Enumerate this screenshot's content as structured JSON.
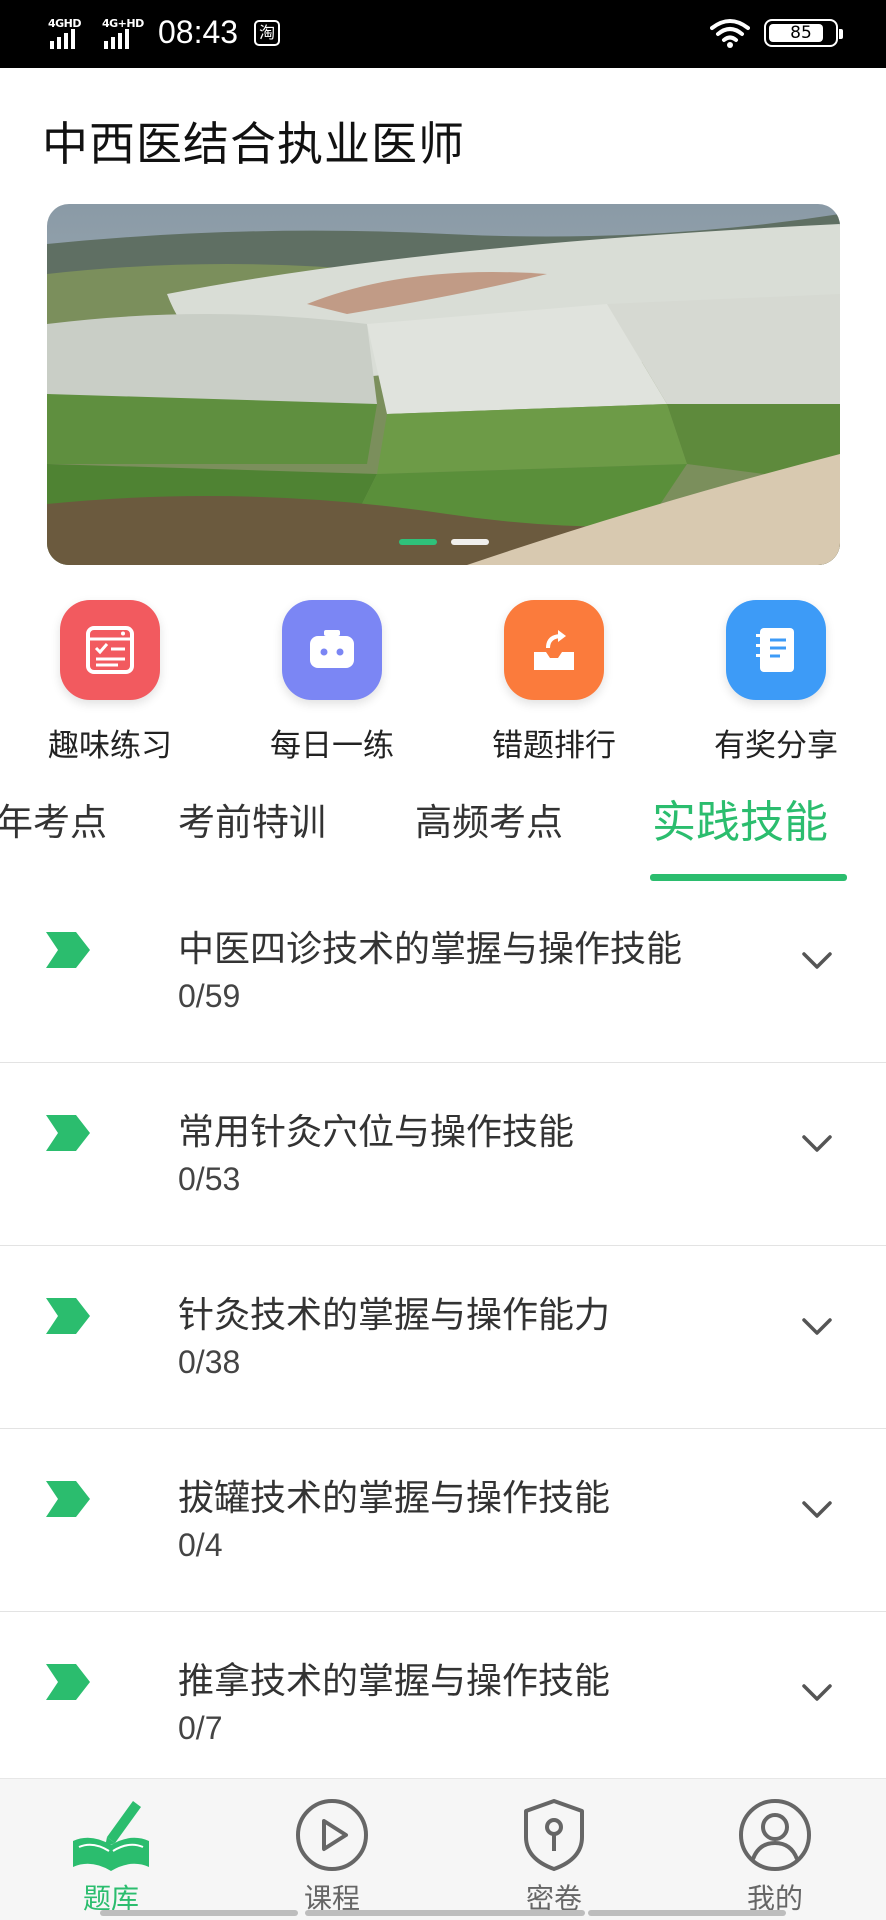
{
  "status_bar": {
    "signal1_tag": "4GHD",
    "signal2_tag": "4G+HD",
    "time": "08:43",
    "app_glyph": "淘",
    "battery_level": 85,
    "battery_text": "85",
    "icons": [
      "signal-icon",
      "wifi-icon",
      "battery-icon"
    ]
  },
  "header": {
    "title": "中西医结合执业医师"
  },
  "banner": {
    "slide_count": 2,
    "active_slide": 0
  },
  "quick_actions": [
    {
      "label": "趣味练习",
      "icon": "practice-icon",
      "color": "#f25a5f"
    },
    {
      "label": "每日一练",
      "icon": "robot-icon",
      "color": "#7b86f4"
    },
    {
      "label": "错题排行",
      "icon": "share-box-icon",
      "color": "#fb7b3c"
    },
    {
      "label": "有奖分享",
      "icon": "notebook-icon",
      "color": "#3d9bf7"
    }
  ],
  "tabs": [
    {
      "label": "历年考点"
    },
    {
      "label": "考前特训"
    },
    {
      "label": "高频考点"
    },
    {
      "label": "实践技能",
      "active": true
    }
  ],
  "tab_partial_visible": "年考点",
  "list": [
    {
      "title": "中医四诊技术的掌握与操作技能",
      "progress": "0/59"
    },
    {
      "title": "常用针灸穴位与操作技能",
      "progress": "0/53"
    },
    {
      "title": "针灸技术的掌握与操作能力",
      "progress": "0/38"
    },
    {
      "title": "拔罐技术的掌握与操作技能",
      "progress": "0/4"
    },
    {
      "title": "推拿技术的掌握与操作技能",
      "progress": "0/7"
    }
  ],
  "bottom_nav": [
    {
      "label": "题库",
      "icon": "book-pen-icon",
      "active": true
    },
    {
      "label": "课程",
      "icon": "play-circle-icon"
    },
    {
      "label": "密卷",
      "icon": "shield-key-icon"
    },
    {
      "label": "我的",
      "icon": "user-circle-icon"
    }
  ],
  "colors": {
    "accent": "#2bbd6e",
    "divider": "#e3e3e3"
  }
}
